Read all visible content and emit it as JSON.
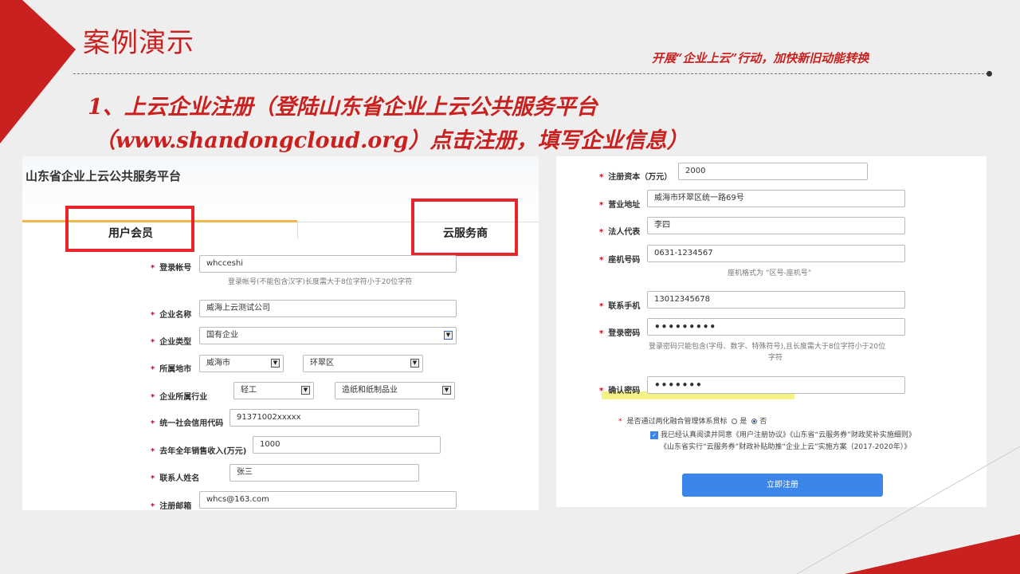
{
  "slide": {
    "title": "案例演示",
    "slogan": "开展“企业上云”行动，加快新旧动能转换",
    "heading_line1": "1、上云企业注册（登陆山东省企业上云公共服务平台",
    "heading_line2": "（www.shandongcloud.org）点击注册，填写企业信息）",
    "accent_color": "#c8211f"
  },
  "left_form": {
    "site_title": "山东省企业上云公共服务平台",
    "tab_user": "用户会员",
    "tab_provider": "云服务商",
    "fields": {
      "account_label": "登录帐号",
      "account_value": "whcceshi",
      "account_hint": "登录帐号(不能包含汉字)长度需大于8位字符小于20位字符",
      "company_label": "企业名称",
      "company_value": "威海上云测试公司",
      "type_label": "企业类型",
      "type_value": "国有企业",
      "city_label": "所属地市",
      "city_value": "威海市",
      "district_value": "环翠区",
      "industry_label": "企业所属行业",
      "industry_value": "轻工",
      "sub_industry_value": "造纸和纸制品业",
      "credit_label": "统一社会信用代码",
      "credit_value": "91371002xxxxx",
      "sales_label": "去年全年销售收入(万元)",
      "sales_value": "1000",
      "contact_label": "联系人姓名",
      "contact_value": "张三",
      "email_label": "注册邮箱",
      "email_value": "whcs@163.com"
    }
  },
  "right_form": {
    "capital_label": "注册资本（万元）",
    "capital_value": "2000",
    "address_label": "营业地址",
    "address_value": "威海市环翠区统一路69号",
    "legal_label": "法人代表",
    "legal_value": "李四",
    "phone_label": "座机号码",
    "phone_value": "0631-1234567",
    "phone_hint": "座机格式为 “区号-座机号”",
    "mobile_label": "联系手机",
    "mobile_value": "13012345678",
    "password_label": "登录密码",
    "password_value": "•••••••••",
    "password_hint_1": "登录密码只能包含(字母、数字、特殊符号),且长度需大于8位字符小于20位",
    "password_hint_2": "字符",
    "confirm_label": "确认密码",
    "confirm_value": "•••••••",
    "fusion_question": "是否通过两化融合管理体系贯标",
    "option_yes": "是",
    "option_no": "否",
    "agree_line1": "我已经认真阅读并同意《用户注册协议》《山东省“云服务券”财政奖补实施细则》",
    "agree_line2": "《山东省实行“云服务券”财政补贴助推“企业上云”实施方案（2017-2020年）》",
    "submit_label": "立即注册",
    "submit_color": "#3b86e8"
  }
}
